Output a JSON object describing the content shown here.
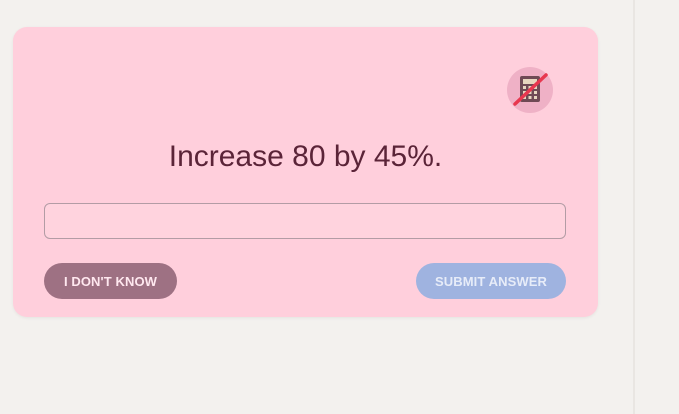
{
  "question": {
    "text": "Increase 80 by 45%."
  },
  "calculator_badge": {
    "icon": "calculator-disabled-icon",
    "colors": {
      "badge": "#efb1c6",
      "slash": "#e8374f"
    }
  },
  "answer_input": {
    "value": "",
    "placeholder": ""
  },
  "buttons": {
    "dont_know": "I DON'T KNOW",
    "submit": "SUBMIT ANSWER"
  },
  "colors": {
    "card": "#ffcfdc",
    "text": "#5b2438",
    "dont_know_button": "#9e7183",
    "submit_button": "#9fb3e0",
    "background": "#f3f1ee"
  }
}
